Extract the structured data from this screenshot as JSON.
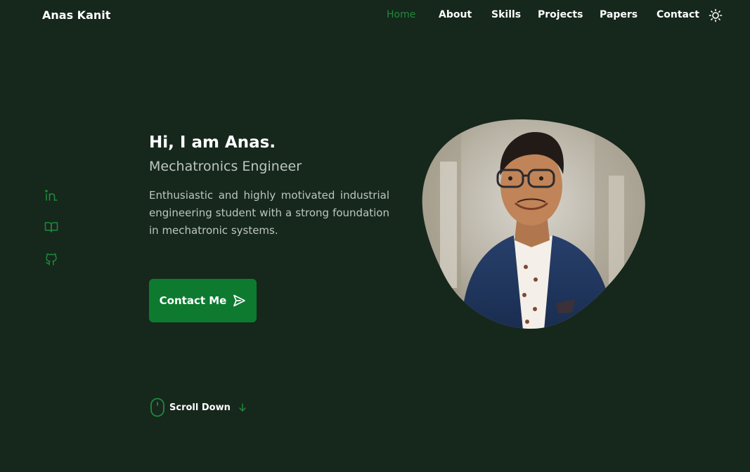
{
  "header": {
    "logo": "Anas Kanit",
    "nav": [
      {
        "label": "Home",
        "active": true
      },
      {
        "label": "About",
        "active": false
      },
      {
        "label": "Skills",
        "active": false
      },
      {
        "label": "Projects",
        "active": false
      },
      {
        "label": "Papers",
        "active": false
      },
      {
        "label": "Contact",
        "active": false
      }
    ],
    "theme_toggle_icon": "sun-icon"
  },
  "social": [
    {
      "icon": "linkedin-icon"
    },
    {
      "icon": "book-open-icon"
    },
    {
      "icon": "github-icon"
    }
  ],
  "hero": {
    "title": "Hi, I am Anas.",
    "subtitle": "Mechatronics Engineer",
    "description": "Enthusiastic and highly motivated industrial engineering student with a strong foundation in mechatronic systems.",
    "button_label": "Contact Me",
    "button_icon": "send-icon"
  },
  "scroll": {
    "label": "Scroll Down",
    "mouse_icon": "mouse-icon",
    "arrow_icon": "arrow-down-icon"
  },
  "colors": {
    "background": "#16271c",
    "accent": "#0d7a30",
    "accent_text": "#1f8a3a",
    "muted_text": "#bcc6c0"
  }
}
